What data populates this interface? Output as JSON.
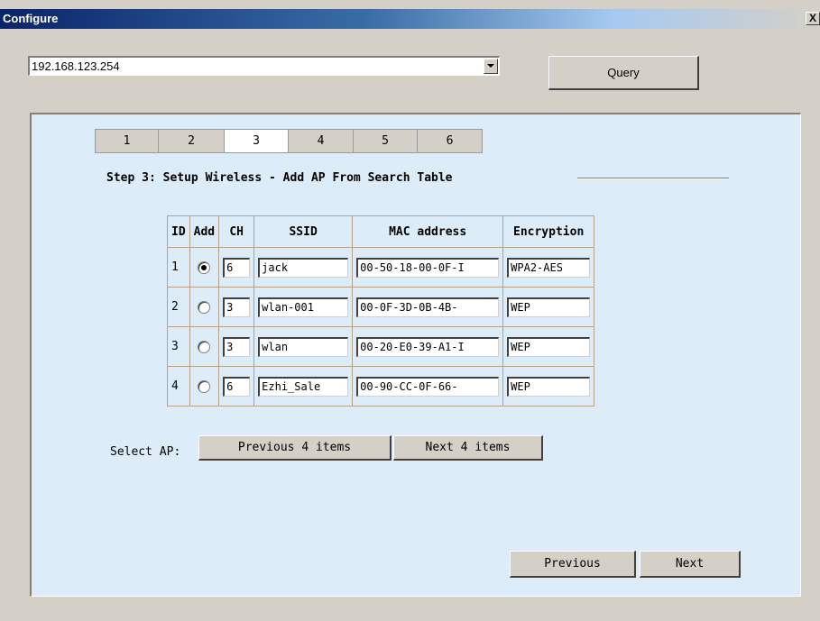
{
  "window": {
    "title": "Configure",
    "close_label": "X"
  },
  "ip_select": {
    "value": "192.168.123.254"
  },
  "query_button": "Query",
  "tabs": [
    "1",
    "2",
    "3",
    "4",
    "5",
    "6"
  ],
  "active_tab": "3",
  "step_heading": "Step 3: Setup Wireless - Add AP From Search Table",
  "table": {
    "headers": [
      "ID",
      "Add",
      "CH",
      "SSID",
      "MAC address",
      "Encryption"
    ],
    "rows": [
      {
        "id": "1",
        "selected": true,
        "ch": "6",
        "ssid": "jack",
        "mac": "00-50-18-00-0F-I",
        "enc": "WPA2-AES"
      },
      {
        "id": "2",
        "selected": false,
        "ch": "3",
        "ssid": "wlan-001",
        "mac": "00-0F-3D-0B-4B-",
        "enc": "WEP"
      },
      {
        "id": "3",
        "selected": false,
        "ch": "3",
        "ssid": "wlan",
        "mac": "00-20-E0-39-A1-I",
        "enc": "WEP"
      },
      {
        "id": "4",
        "selected": false,
        "ch": "6",
        "ssid": "Ezhi_Sale",
        "mac": "00-90-CC-0F-66-",
        "enc": "WEP"
      }
    ]
  },
  "select_ap_label": "Select AP:",
  "prev_items_button": "Previous 4 items",
  "next_items_button": "Next 4 items",
  "previous_button": "Previous",
  "next_button": "Next"
}
